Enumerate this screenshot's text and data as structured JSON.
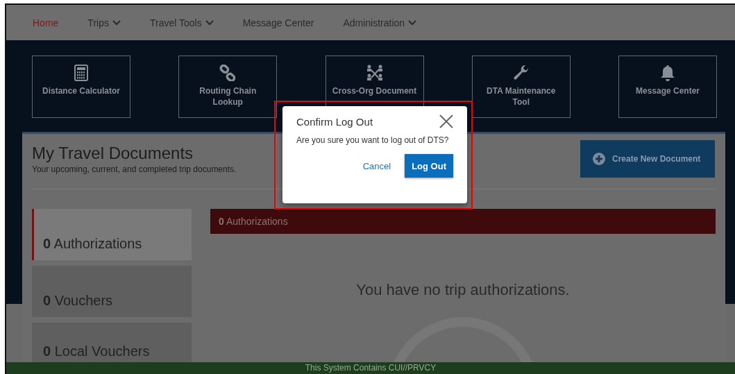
{
  "nav": [
    {
      "label": "Home",
      "selected": true,
      "dropdown": false
    },
    {
      "label": "Trips",
      "selected": false,
      "dropdown": true
    },
    {
      "label": "Travel Tools",
      "selected": false,
      "dropdown": true
    },
    {
      "label": "Message Center",
      "selected": false,
      "dropdown": false
    },
    {
      "label": "Administration",
      "selected": false,
      "dropdown": true
    }
  ],
  "tools": [
    {
      "kind": "calculator",
      "label": "Distance Calculator"
    },
    {
      "kind": "chain",
      "label": "Routing Chain Lookup"
    },
    {
      "kind": "network",
      "label": "Cross-Org Document"
    },
    {
      "kind": "wrench",
      "label": "DTA Maintenance Tool"
    },
    {
      "kind": "bell",
      "label": "Message Center"
    }
  ],
  "page": {
    "title": "My Travel Documents",
    "subtitle": "Your upcoming, current, and completed trip documents.",
    "create_button": "Create New Document"
  },
  "doc_tabs": [
    {
      "count": "0",
      "label": "Authorizations",
      "selected": true
    },
    {
      "count": "0",
      "label": "Vouchers",
      "selected": false
    },
    {
      "count": "0",
      "label": "Local Vouchers",
      "selected": false
    }
  ],
  "results": {
    "header_count": "0",
    "header_label": "Authorizations",
    "empty_message": "You have no trip authorizations."
  },
  "dialog": {
    "title": "Confirm Log Out",
    "message": "Are you sure you want to log out of DTS?",
    "cancel": "Cancel",
    "confirm": "Log Out"
  },
  "footer": "This System Contains CUI//PRVCY"
}
